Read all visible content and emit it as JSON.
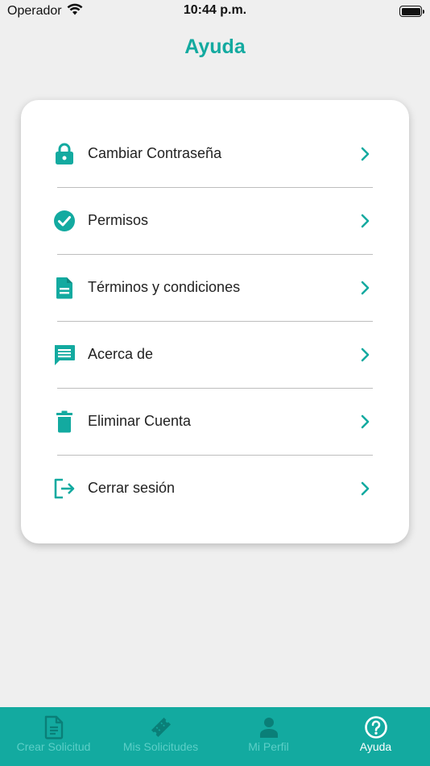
{
  "status_bar": {
    "carrier": "Operador",
    "time": "10:44 p.m."
  },
  "header": {
    "title": "Ayuda"
  },
  "colors": {
    "accent": "#13aaa0",
    "background": "#efefef",
    "card": "#ffffff",
    "tab_inactive": "#5ccfc7",
    "tab_active": "#ffffff"
  },
  "menu": {
    "items": [
      {
        "label": "Cambiar Contraseña",
        "icon": "lock-icon"
      },
      {
        "label": "Permisos",
        "icon": "check-circle-icon"
      },
      {
        "label": "Términos y condiciones",
        "icon": "document-icon"
      },
      {
        "label": "Acerca de",
        "icon": "message-icon"
      },
      {
        "label": "Eliminar Cuenta",
        "icon": "trash-icon"
      },
      {
        "label": "Cerrar sesión",
        "icon": "logout-icon"
      }
    ]
  },
  "tab_bar": {
    "tabs": [
      {
        "label": "Crear Solicitud",
        "icon": "document-edit-icon",
        "active": false
      },
      {
        "label": "Mis Solicitudes",
        "icon": "ticket-icon",
        "active": false
      },
      {
        "label": "Mi Perfil",
        "icon": "person-icon",
        "active": false
      },
      {
        "label": "Ayuda",
        "icon": "help-circle-icon",
        "active": true
      }
    ]
  }
}
